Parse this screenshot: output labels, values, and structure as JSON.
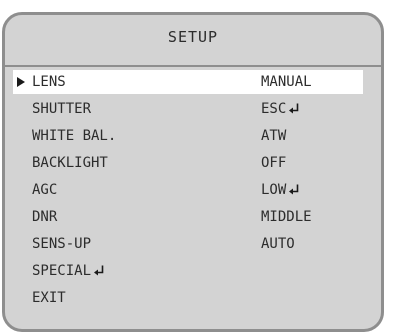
{
  "title": "SETUP",
  "menu": {
    "items": [
      {
        "label": "LENS",
        "value": "MANUAL",
        "selected": true,
        "label_has_enter": false,
        "value_has_enter": false
      },
      {
        "label": "SHUTTER",
        "value": "ESC",
        "selected": false,
        "label_has_enter": false,
        "value_has_enter": true
      },
      {
        "label": "WHITE BAL.",
        "value": "ATW",
        "selected": false,
        "label_has_enter": false,
        "value_has_enter": false
      },
      {
        "label": "BACKLIGHT",
        "value": "OFF",
        "selected": false,
        "label_has_enter": false,
        "value_has_enter": false
      },
      {
        "label": "AGC",
        "value": "LOW",
        "selected": false,
        "label_has_enter": false,
        "value_has_enter": true
      },
      {
        "label": "DNR",
        "value": "MIDDLE",
        "selected": false,
        "label_has_enter": false,
        "value_has_enter": false
      },
      {
        "label": "SENS-UP",
        "value": "AUTO",
        "selected": false,
        "label_has_enter": false,
        "value_has_enter": false
      },
      {
        "label": "SPECIAL",
        "value": "",
        "selected": false,
        "label_has_enter": true,
        "value_has_enter": false
      },
      {
        "label": "EXIT",
        "value": "",
        "selected": false,
        "label_has_enter": false,
        "value_has_enter": false
      }
    ]
  },
  "icons": {
    "selection": "pointer-triangle-icon",
    "submenu": "enter-return-icon"
  },
  "colors": {
    "panel_background": "#d3d3d3",
    "panel_border": "#8e8e8e",
    "selected_row": "#ffffff",
    "text": "#2c2c2c"
  }
}
